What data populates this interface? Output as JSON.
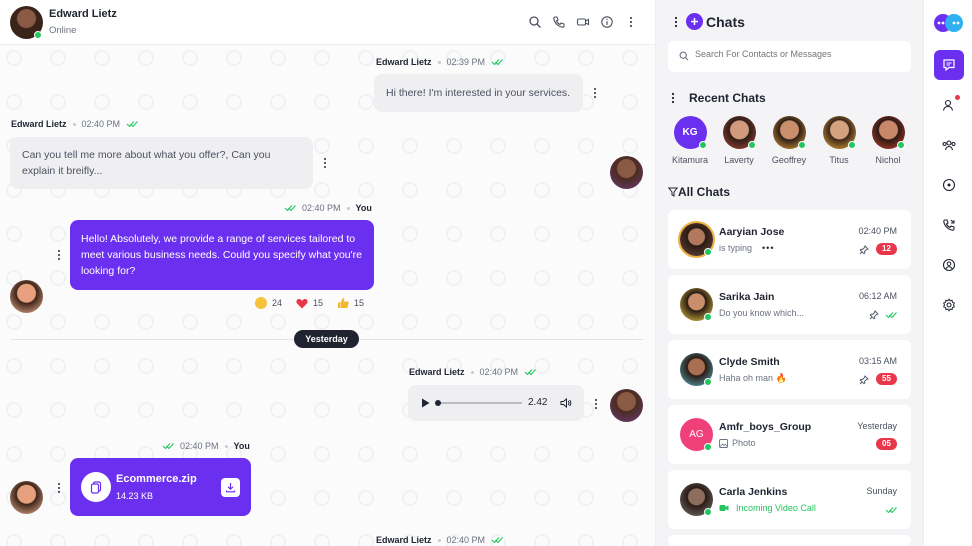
{
  "colors": {
    "accent": "#6b2ff0",
    "online": "#22c55e",
    "badge": "#e8364a",
    "bubble_in": "#efeff2"
  },
  "conversation": {
    "contact_name": "Edward Lietz",
    "contact_status": "Online",
    "header_icons": [
      "search-icon",
      "phone-icon",
      "video-icon",
      "info-icon",
      "more-vertical-icon"
    ],
    "messages": [
      {
        "sender": "Edward Lietz",
        "time": "02:39 PM",
        "text": "Hi there! I'm interested in your services."
      },
      {
        "sender": "Edward Lietz",
        "time": "02:40 PM",
        "text": "Can you tell me more about what you offer?, Can you explain it breifly..."
      },
      {
        "sender": "You",
        "time": "02:40 PM",
        "text": "Hello! Absolutely, we provide a range of services tailored to meet various business needs. Could you specify what you're looking for?",
        "reactions": [
          {
            "emoji": "grinning-face",
            "count": "24"
          },
          {
            "emoji": "red-heart",
            "count": "15"
          },
          {
            "emoji": "thumbs-up",
            "count": "15"
          }
        ]
      },
      {
        "sender": "Edward Lietz",
        "time": "02:40 PM",
        "type": "audio",
        "duration": "2.42"
      },
      {
        "sender": "You",
        "time": "02:40 PM",
        "type": "file",
        "file_name": "Ecommerce.zip",
        "file_size": "14.23 KB"
      },
      {
        "sender": "Edward Lietz",
        "time": "02:40 PM"
      }
    ],
    "day_separator": "Yesterday"
  },
  "chats_panel": {
    "title": "Chats",
    "search_placeholder": "Search For Contacts or Messages",
    "recent_title": "Recent Chats",
    "recent": [
      {
        "name": "Kitamura",
        "initials": "KG",
        "color": "#6b2ff0"
      },
      {
        "name": "Laverty",
        "color": "#b54a3d"
      },
      {
        "name": "Geoffrey",
        "color": "#e6a93b"
      },
      {
        "name": "Titus",
        "color": "#f0b040"
      },
      {
        "name": "Nichol",
        "color": "#c8402f"
      }
    ],
    "all_title": "All Chats",
    "chats": [
      {
        "name": "Aaryian Jose",
        "preview": "is typing",
        "time": "02:40 PM",
        "badge": "12",
        "pinned": true
      },
      {
        "name": "Sarika Jain",
        "preview": "Do you know which...",
        "time": "06:12 AM",
        "pinned": true,
        "read": true
      },
      {
        "name": "Clyde Smith",
        "preview": "Haha oh man 🔥",
        "time": "03:15 AM",
        "badge": "55",
        "pinned": true
      },
      {
        "name": "Amfr_boys_Group",
        "initials": "AG",
        "preview": "Photo",
        "time": "Yesterday",
        "badge": "05"
      },
      {
        "name": "Carla Jenkins",
        "preview": "Incoming Video Call",
        "time": "Sunday",
        "read": true
      }
    ]
  },
  "rail": {
    "items": [
      "chat-icon",
      "user-icon",
      "group-icon",
      "status-icon",
      "calls-icon",
      "profile-icon",
      "settings-icon"
    ],
    "active": "chat-icon"
  }
}
